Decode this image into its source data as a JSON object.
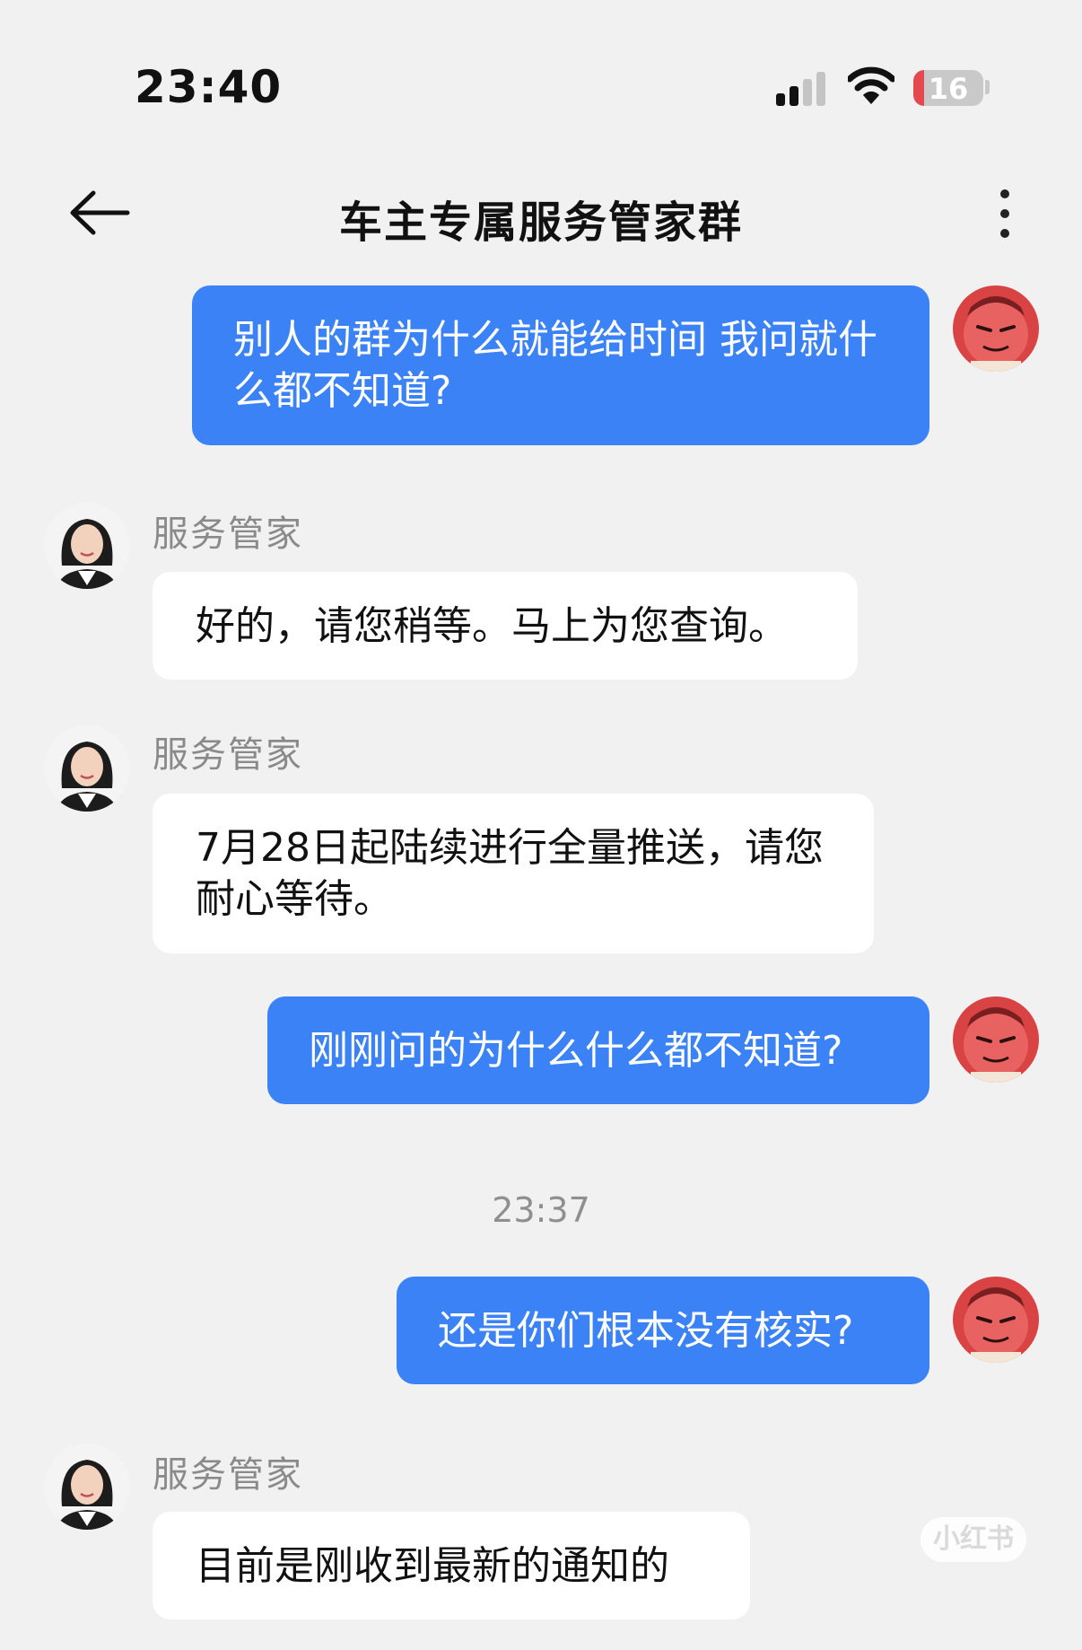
{
  "status_bar": {
    "time": "23:40",
    "battery": "16",
    "battery_level": 0.16
  },
  "header": {
    "title": "车主专属服务管家群"
  },
  "messages": [
    {
      "direction": "outgoing",
      "text": "别人的群为什么就能给时间 我问就什么都不知道?"
    },
    {
      "direction": "incoming",
      "sender": "服务管家",
      "text": "好的，请您稍等。马上为您查询。"
    },
    {
      "direction": "incoming",
      "sender": "服务管家",
      "text": "7月28日起陆续进行全量推送，请您耐心等待。"
    },
    {
      "direction": "outgoing",
      "text": "刚刚问的为什么什么都不知道?"
    },
    {
      "timestamp": "23:37"
    },
    {
      "direction": "outgoing",
      "text": "还是你们根本没有核实?"
    },
    {
      "direction": "incoming",
      "sender": "服务管家",
      "text": "目前是刚收到最新的通知的"
    }
  ],
  "watermark": "小红书",
  "colors": {
    "outgoing_bubble": "#3b82f6",
    "incoming_bubble": "#ffffff",
    "background": "#f1f1f1",
    "battery": "#e5484d"
  }
}
